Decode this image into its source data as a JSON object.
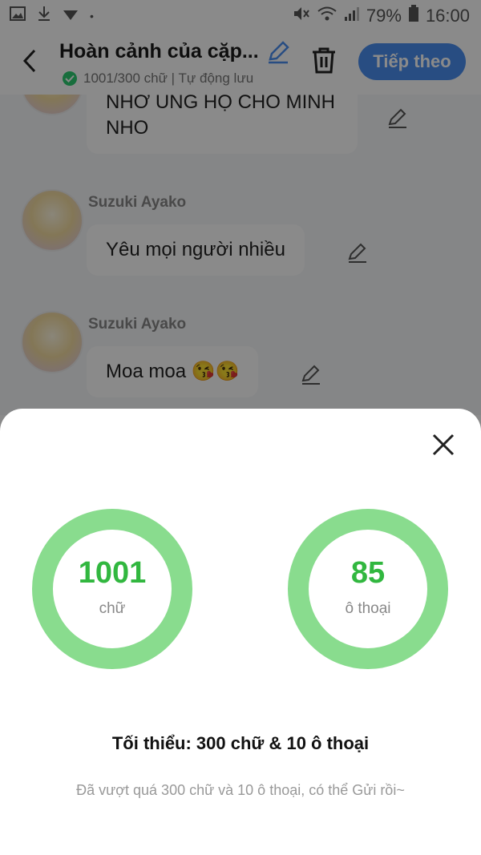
{
  "status_bar": {
    "battery": "79%",
    "time": "16:00"
  },
  "header": {
    "title": "Hoàn cảnh của cặp...",
    "subtitle": "1001/300 chữ | Tự động lưu",
    "next_label": "Tiếp theo"
  },
  "chat": {
    "messages": [
      {
        "sender": "",
        "text": "NHỚ ỦNG HỘ CHO MÌNH NHO"
      },
      {
        "sender": "Suzuki Ayako",
        "text": "Yêu mọi người nhiều"
      },
      {
        "sender": "Suzuki Ayako",
        "text": "Moa moa 😘😘"
      }
    ]
  },
  "stats": {
    "words": {
      "value": "1001",
      "label": "chữ"
    },
    "dialogues": {
      "value": "85",
      "label": "ô thoại"
    },
    "minimum": "Tối thiểu: 300 chữ & 10 ô thoại",
    "hint": "Đã vượt quá 300 chữ và 10 ô thoại, có thể Gửi rồi~"
  },
  "colors": {
    "accent": "#4a8ef0",
    "ring": "#89dc8e",
    "ring_text": "#31b73f"
  }
}
